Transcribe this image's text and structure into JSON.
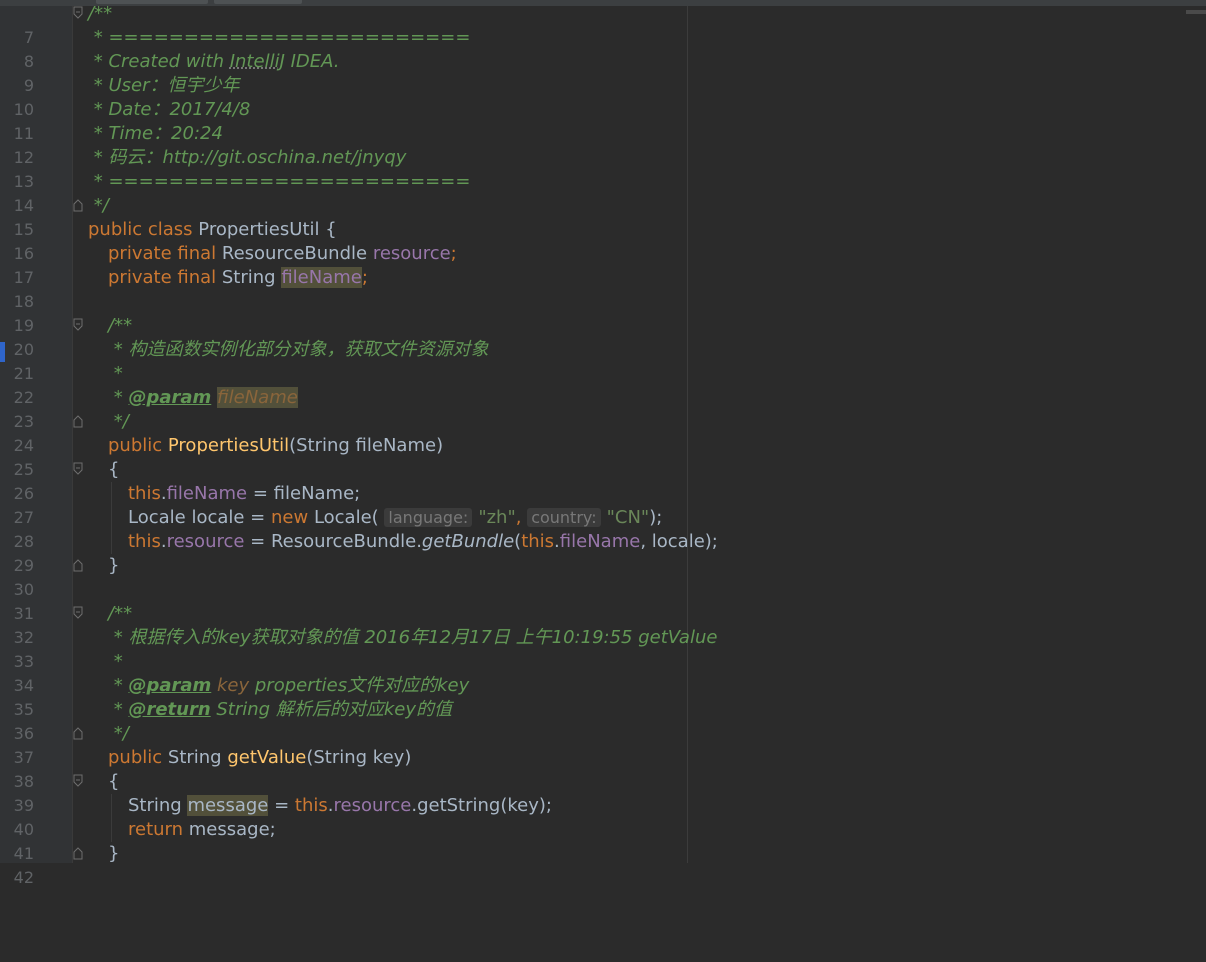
{
  "editor": {
    "line_numbers": [
      "7",
      "8",
      "9",
      "10",
      "11",
      "12",
      "13",
      "14",
      "15",
      "16",
      "17",
      "18",
      "19",
      "20",
      "21",
      "22",
      "23",
      "24",
      "25",
      "26",
      "27",
      "28",
      "29",
      "30",
      "31",
      "32",
      "33",
      "34",
      "35",
      "36",
      "37",
      "38",
      "39",
      "40",
      "41",
      "42"
    ],
    "header_comment": {
      "open": "/**",
      "rule": " * ========================",
      "created_prefix": " * Created with ",
      "created_ide": "IntelliJ",
      "created_suffix": " IDEA.",
      "user": " * User：恒宇少年",
      "date": " * Date：2017/4/8",
      "time": " * Time：20:24",
      "repo": " * 码云：http://git.oschina.net/jnyqy",
      "close": " */"
    },
    "class_decl": {
      "mods": "public class ",
      "name": "PropertiesUtil",
      "brace": " {"
    },
    "field1": {
      "mods": "private final ",
      "type": "ResourceBundle ",
      "name": "resource",
      "end": ";"
    },
    "field2": {
      "mods": "private final ",
      "type": "String ",
      "name": "fileName",
      "end": ";"
    },
    "ctor_doc": {
      "open": "/**",
      "desc": " * 构造函数实例化部分对象，获取文件资源对象",
      "star": " *",
      "param_prefix": " * ",
      "param_tag": "@param",
      "param_name": "fileName",
      "close": " */"
    },
    "ctor": {
      "mods": "public ",
      "name": "PropertiesUtil",
      "sig": "(String fileName)",
      "open_brace": "{",
      "close_brace": "}",
      "s1_this": "this",
      "s1_dot": ".",
      "s1_field": "fileName",
      "s1_rest": " = fileName;",
      "s2_a": "Locale locale = ",
      "s2_new": "new ",
      "s2_b": "Locale( ",
      "s2_hint1": "language:",
      "s2_str1": "\"zh\"",
      "s2_comma": ", ",
      "s2_hint2": "country:",
      "s2_str2": "\"CN\"",
      "s2_end": ");",
      "s3_this": "this",
      "s3_dot": ".",
      "s3_field": "resource",
      "s3_eq": " = ResourceBundle.",
      "s3_method": "getBundle",
      "s3_paren": "(",
      "s3_this2": "this",
      "s3_dot2": ".",
      "s3_field2": "fileName",
      "s3_end": ", locale);"
    },
    "getvalue_doc": {
      "open": "/**",
      "desc": " * 根据传入的key获取对象的值 2016年12月17日 上午10:19:55 getValue",
      "star": " *",
      "param_prefix": " * ",
      "param_tag": "@param",
      "param_name": " key",
      "param_desc": " properties文件对应的key",
      "return_prefix": " * ",
      "return_tag": "@return",
      "return_desc": " String 解析后的对应key的值",
      "close": " */"
    },
    "getvalue": {
      "mods": "public ",
      "type": "String ",
      "name": "getValue",
      "sig": "(String key)",
      "open_brace": "{",
      "s1_type": "String ",
      "s1_var": "message",
      "s1_eq": " = ",
      "s1_this": "this",
      "s1_dot": ".",
      "s1_field": "resource",
      "s1_rest": ".getString(key);",
      "s2_kw": "return ",
      "s2_rest": "message;",
      "close_brace": "}"
    }
  },
  "colors": {
    "background": "#2b2b2b",
    "gutter": "#313335",
    "keyword": "#cc7832",
    "field": "#9876aa",
    "method": "#ffc66d",
    "string": "#6a8759",
    "comment": "#629755",
    "text": "#a9b7c6",
    "line_number": "#606366"
  }
}
